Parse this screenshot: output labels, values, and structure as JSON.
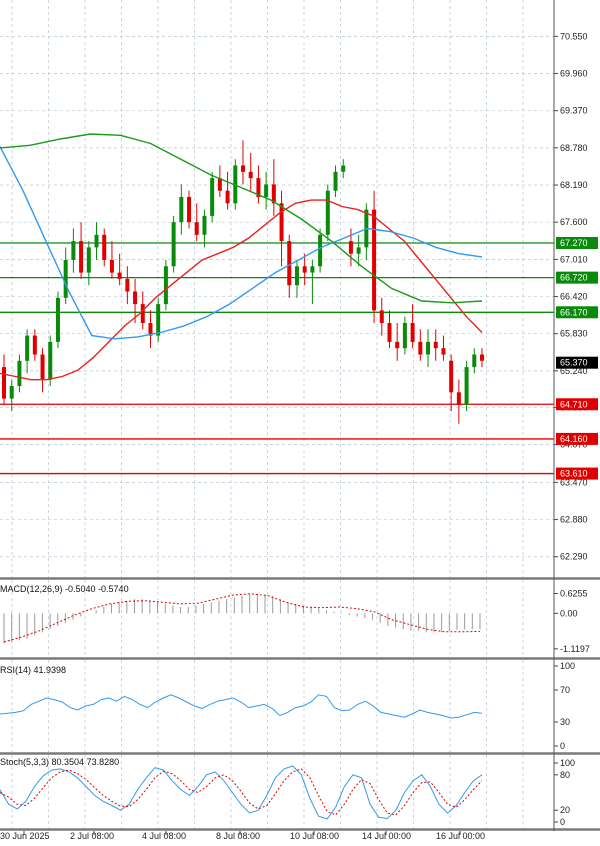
{
  "chart_data": {
    "type": "candlestick",
    "price_panel": {
      "y_ticks": [
        "70.550",
        "69.960",
        "69.370",
        "68.780",
        "68.190",
        "67.600",
        "67.010",
        "66.420",
        "65.830",
        "65.240",
        "64.660",
        "64.070",
        "63.470",
        "62.880",
        "62.290"
      ],
      "ylim": [
        62.0,
        71.0
      ],
      "levels": [
        {
          "value": 67.27,
          "label": "67.270",
          "color": "#0a8a0a"
        },
        {
          "value": 66.72,
          "label": "66.720",
          "color": "#0a8a0a"
        },
        {
          "value": 66.17,
          "label": "66.170",
          "color": "#0a8a0a"
        },
        {
          "value": 64.71,
          "label": "64.710",
          "color": "#e00000"
        },
        {
          "value": 64.16,
          "label": "64.160",
          "color": "#e00000"
        },
        {
          "value": 63.61,
          "label": "63.610",
          "color": "#e00000"
        }
      ],
      "last_price": {
        "value": 65.37,
        "label": "65.370",
        "color": "#000000"
      },
      "candles": [
        [
          65.3,
          65.5,
          64.7,
          64.8
        ],
        [
          64.8,
          65.1,
          64.6,
          65.0
        ],
        [
          65.0,
          65.5,
          64.9,
          65.4
        ],
        [
          65.4,
          65.9,
          65.2,
          65.8
        ],
        [
          65.8,
          65.9,
          65.4,
          65.5
        ],
        [
          65.5,
          65.6,
          64.9,
          65.1
        ],
        [
          65.1,
          65.8,
          65.0,
          65.7
        ],
        [
          65.7,
          66.5,
          65.6,
          66.4
        ],
        [
          66.4,
          67.2,
          66.3,
          67.0
        ],
        [
          67.0,
          67.5,
          66.8,
          67.3
        ],
        [
          67.3,
          67.6,
          66.7,
          66.8
        ],
        [
          66.8,
          67.3,
          66.6,
          67.2
        ],
        [
          67.2,
          67.6,
          67.0,
          67.4
        ],
        [
          67.4,
          67.5,
          66.9,
          67.0
        ],
        [
          67.0,
          67.3,
          66.7,
          66.8
        ],
        [
          66.8,
          67.1,
          66.6,
          66.7
        ],
        [
          66.7,
          66.9,
          66.3,
          66.5
        ],
        [
          66.5,
          66.7,
          66.0,
          66.3
        ],
        [
          66.3,
          66.5,
          65.9,
          66.0
        ],
        [
          66.0,
          66.2,
          65.6,
          65.8
        ],
        [
          65.8,
          66.4,
          65.7,
          66.3
        ],
        [
          66.3,
          67.0,
          66.2,
          66.9
        ],
        [
          66.9,
          67.7,
          66.8,
          67.6
        ],
        [
          67.6,
          68.2,
          67.4,
          68.0
        ],
        [
          68.0,
          68.1,
          67.5,
          67.6
        ],
        [
          67.6,
          67.9,
          67.3,
          67.4
        ],
        [
          67.4,
          67.8,
          67.2,
          67.7
        ],
        [
          67.7,
          68.4,
          67.6,
          68.3
        ],
        [
          68.3,
          68.5,
          68.0,
          68.1
        ],
        [
          68.1,
          68.4,
          67.8,
          67.9
        ],
        [
          67.9,
          68.6,
          67.8,
          68.5
        ],
        [
          68.5,
          68.9,
          68.2,
          68.4
        ],
        [
          68.4,
          68.7,
          68.1,
          68.3
        ],
        [
          68.3,
          68.5,
          67.9,
          68.0
        ],
        [
          68.0,
          68.4,
          67.8,
          68.2
        ],
        [
          68.2,
          68.6,
          67.7,
          67.9
        ],
        [
          67.9,
          68.1,
          66.9,
          67.3
        ],
        [
          67.3,
          67.4,
          66.4,
          66.6
        ],
        [
          66.6,
          67.0,
          66.4,
          66.9
        ],
        [
          66.9,
          67.1,
          66.6,
          66.8
        ],
        [
          66.8,
          67.0,
          66.3,
          66.9
        ],
        [
          66.9,
          67.5,
          66.8,
          67.4
        ],
        [
          67.4,
          68.2,
          67.3,
          68.1
        ],
        [
          68.1,
          68.5,
          68.0,
          68.4
        ],
        [
          68.4,
          68.6,
          68.3,
          68.5
        ],
        [
          67.3,
          67.5,
          66.9,
          67.1
        ],
        [
          67.1,
          67.4,
          66.9,
          67.2
        ],
        [
          67.2,
          67.9,
          67.0,
          67.8
        ],
        [
          67.8,
          68.1,
          66.0,
          66.2
        ],
        [
          66.2,
          66.4,
          65.8,
          66.0
        ],
        [
          66.0,
          66.2,
          65.6,
          65.7
        ],
        [
          65.7,
          66.0,
          65.4,
          65.6
        ],
        [
          65.6,
          66.1,
          65.5,
          66.0
        ],
        [
          66.0,
          66.3,
          65.6,
          65.7
        ],
        [
          65.7,
          65.9,
          65.4,
          65.5
        ],
        [
          65.5,
          65.9,
          65.3,
          65.7
        ],
        [
          65.7,
          65.9,
          65.4,
          65.6
        ],
        [
          65.6,
          65.8,
          65.4,
          65.5
        ],
        [
          65.4,
          65.5,
          64.6,
          64.9
        ],
        [
          64.9,
          65.1,
          64.4,
          64.7
        ],
        [
          64.7,
          65.4,
          64.6,
          65.3
        ],
        [
          65.3,
          65.6,
          65.2,
          65.5
        ],
        [
          65.5,
          65.6,
          65.3,
          65.4
        ]
      ],
      "ma_red": [
        65.2,
        65.15,
        65.1,
        65.1,
        65.15,
        65.25,
        65.45,
        65.7,
        65.95,
        66.15,
        66.4,
        66.6,
        66.8,
        67.0,
        67.1,
        67.2,
        67.35,
        67.55,
        67.75,
        67.9,
        67.95,
        67.95,
        67.85,
        67.8,
        67.7,
        67.5,
        67.3,
        67.0,
        66.7,
        66.4,
        66.1,
        65.85
      ],
      "ma_blue": [
        68.8,
        68.1,
        67.3,
        66.5,
        65.8,
        65.75,
        65.78,
        65.85,
        65.95,
        66.1,
        66.3,
        66.55,
        66.8,
        67.0,
        67.2,
        67.35,
        67.5,
        67.45,
        67.35,
        67.2,
        67.1,
        67.05
      ],
      "ma_green": [
        68.78,
        68.82,
        68.92,
        69.0,
        68.98,
        68.85,
        68.6,
        68.35,
        68.15,
        67.95,
        67.65,
        67.3,
        66.9,
        66.55,
        66.35,
        66.32,
        66.35
      ]
    },
    "macd": {
      "title": "MACD(12,26,9) -0.5040 -0.5740",
      "y_ticks": [
        "0.6255",
        "0.00",
        "-1.1197"
      ],
      "ylim": [
        -1.25,
        0.8
      ],
      "histogram": [
        -0.95,
        -0.9,
        -0.85,
        -0.8,
        -0.7,
        -0.6,
        -0.5,
        -0.4,
        -0.3,
        -0.2,
        -0.1,
        0.0,
        0.1,
        0.2,
        0.3,
        0.35,
        0.4,
        0.45,
        0.45,
        0.4,
        0.35,
        0.3,
        0.25,
        0.2,
        0.2,
        0.25,
        0.3,
        0.35,
        0.4,
        0.45,
        0.5,
        0.55,
        0.6,
        0.62,
        0.6,
        0.55,
        0.45,
        0.35,
        0.3,
        0.25,
        0.2,
        0.15,
        0.1,
        0.05,
        0.02,
        -0.05,
        -0.1,
        -0.15,
        -0.2,
        -0.3,
        -0.4,
        -0.45,
        -0.5,
        -0.55,
        -0.55,
        -0.6,
        -0.6,
        -0.58,
        -0.55,
        -0.52,
        -0.5,
        -0.5,
        -0.5
      ],
      "signal": [
        -0.9,
        -0.75,
        -0.55,
        -0.3,
        -0.05,
        0.15,
        0.3,
        0.38,
        0.4,
        0.35,
        0.3,
        0.32,
        0.45,
        0.58,
        0.62,
        0.55,
        0.35,
        0.2,
        0.18,
        0.2,
        0.15,
        0.05,
        -0.2,
        -0.35,
        -0.5,
        -0.58,
        -0.58,
        -0.57
      ]
    },
    "rsi": {
      "title": "RSI(14) 41.9398",
      "y_ticks": [
        "100",
        "70",
        "30",
        "0"
      ],
      "ylim": [
        0,
        100
      ],
      "values": [
        40,
        41,
        42,
        44,
        52,
        56,
        60,
        58,
        55,
        48,
        45,
        50,
        52,
        58,
        60,
        56,
        62,
        58,
        52,
        48,
        55,
        60,
        64,
        60,
        55,
        50,
        47,
        52,
        56,
        58,
        60,
        55,
        48,
        50,
        52,
        47,
        38,
        42,
        48,
        50,
        55,
        64,
        62,
        48,
        44,
        45,
        52,
        56,
        50,
        42,
        40,
        38,
        36,
        40,
        45,
        42,
        40,
        38,
        35,
        36,
        39,
        42,
        41
      ]
    },
    "stoch": {
      "title": "Stoch(5,3,3) 80.3504 73.8280",
      "y_ticks": [
        "100",
        "80",
        "20",
        "0"
      ],
      "ylim": [
        0,
        100
      ],
      "k": [
        55,
        30,
        22,
        35,
        60,
        78,
        88,
        90,
        85,
        75,
        60,
        45,
        35,
        28,
        20,
        30,
        55,
        75,
        92,
        88,
        70,
        55,
        45,
        60,
        80,
        85,
        70,
        50,
        30,
        15,
        20,
        45,
        75,
        90,
        95,
        80,
        40,
        10,
        5,
        25,
        60,
        80,
        75,
        30,
        8,
        6,
        20,
        50,
        70,
        80,
        60,
        30,
        15,
        28,
        50,
        70,
        80
      ],
      "d": [
        50,
        42,
        30,
        28,
        40,
        58,
        75,
        85,
        88,
        82,
        72,
        58,
        45,
        35,
        27,
        26,
        38,
        55,
        75,
        86,
        82,
        70,
        55,
        50,
        60,
        75,
        80,
        70,
        52,
        32,
        22,
        28,
        48,
        70,
        85,
        90,
        75,
        45,
        18,
        12,
        30,
        55,
        72,
        65,
        38,
        15,
        12,
        28,
        50,
        67,
        68,
        50,
        30,
        25,
        38,
        55,
        70
      ]
    },
    "x_ticks": [
      "30 Jun 2025",
      "2 Jul 08:00",
      "4 Jul 08:00",
      "8 Jul 08:00",
      "10 Jul 08:00",
      "14 Jul 00:00",
      "16 Jul 00:00"
    ],
    "colors": {
      "up": "#0a8a0a",
      "down": "#e00000",
      "ma_red": "#e82020",
      "ma_blue": "#3399ee",
      "ma_green": "#1a9a1a",
      "grid": "#b9c6d4",
      "signal": "#e00000",
      "hist": "#9a9a9a",
      "rsi": "#3399ee",
      "stoch_k": "#3399ee",
      "stoch_d": "#e00000"
    }
  }
}
